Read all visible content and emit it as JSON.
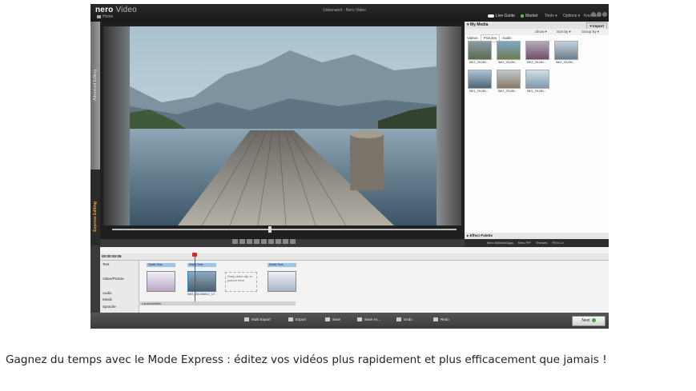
{
  "app": {
    "logo": "nero",
    "product": "Video",
    "home": "Home",
    "window_title": "Unbenannt - Nero Video",
    "live_guide": "Live Guide",
    "market": "Market",
    "menus": [
      "Tools",
      "Options",
      "Knowhow"
    ]
  },
  "side": {
    "advanced": "Advanced Editing",
    "express": "Express Editing"
  },
  "media": {
    "title": "My Media",
    "tabs": [
      "Videos",
      "Pictures",
      "Audio"
    ],
    "active_tab": "Pictures",
    "show": "Show",
    "sort_by": "Sort by",
    "group_by": "Group by",
    "import": "Import",
    "thumbs": [
      "IMG_20180...",
      "IMG_20180...",
      "IMG_20180...",
      "IMG_20180...",
      "IMG_20180...",
      "IMG_20180...",
      "IMG_20180..."
    ],
    "effect_palette": "Effect Palette"
  },
  "fxbar": {
    "items": [
      "Nero MyMonGaga",
      "Nero PiP",
      "Themes",
      "Fit in Ln"
    ]
  },
  "timeline": {
    "timecode": "00:00:00:05",
    "tracks": [
      "Text",
      "Video/Picture",
      "Audio",
      "Musik",
      "Sprache"
    ],
    "clip_headers": [
      "Static Text",
      "Static Text",
      "Static Text"
    ],
    "clip_label": "IMG_20180812_17...",
    "dropzone": "Drag video clip or picture here",
    "audio_clip": "Landschaften"
  },
  "bottom": {
    "multi_export": "Multi Export",
    "export": "Export",
    "save": "Save",
    "save_as": "Save As ...",
    "undo": "Undo",
    "redo": "Redo",
    "next": "Next"
  },
  "caption": "Gagnez du temps avec le Mode Express : éditez vos vidéos plus rapidement et plus efficacement que jamais !",
  "colors": {
    "accent": "#f0a020",
    "titlebar": "#1f1f1f",
    "clip_header": "#9ec4e6",
    "playhead": "#dd2222"
  }
}
